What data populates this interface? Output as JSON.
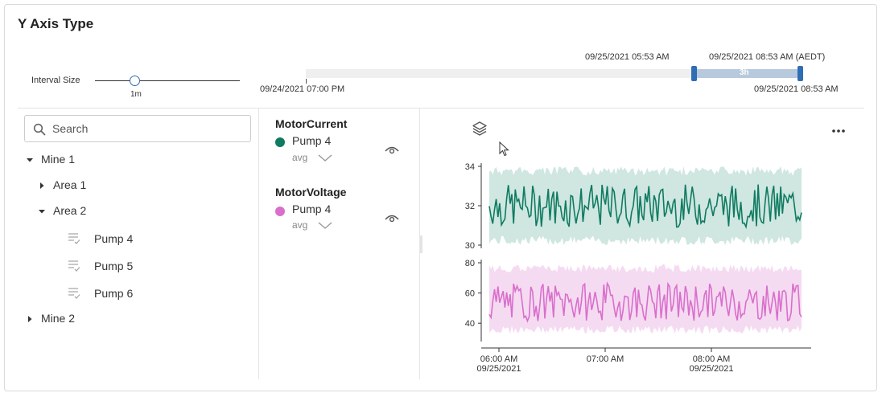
{
  "header": {
    "title": "Y Axis Type"
  },
  "interval": {
    "label": "Interval Size",
    "value": "1m",
    "fraction": 0.45
  },
  "timeline": {
    "start_label": "09/24/2021 07:00 PM",
    "end_label": "09/25/2021 08:53 AM",
    "selection_start_label": "09/25/2021 05:53 AM",
    "selection_end_label": "09/25/2021 08:53 AM (AEDT)",
    "selection_duration": "3h"
  },
  "search": {
    "placeholder": "Search",
    "value": ""
  },
  "tree": {
    "mine1": "Mine 1",
    "area1": "Area 1",
    "area2": "Area 2",
    "pumps": [
      "Pump 4",
      "Pump 5",
      "Pump 6"
    ],
    "mine2": "Mine 2"
  },
  "series": [
    {
      "title": "MotorCurrent",
      "label": "Pump 4",
      "aggregation": "avg",
      "color": "#0f7b61"
    },
    {
      "title": "MotorVoltage",
      "label": "Pump 4",
      "aggregation": "avg",
      "color": "#d96fcc"
    }
  ],
  "colors": {
    "current_line": "#0f7b61",
    "current_band": "#cfe6e1",
    "voltage_line": "#d96fcc",
    "voltage_band": "#f5dbf1",
    "selection": "#b7c9dc",
    "handle": "#2f6db5"
  },
  "chart_data": {
    "type": "line",
    "x_ticks": [
      {
        "time": "06:00 AM",
        "date": "09/25/2021"
      },
      {
        "time": "07:00 AM",
        "date": ""
      },
      {
        "time": "08:00 AM",
        "date": "09/25/2021"
      }
    ],
    "x_range": [
      "09/25/2021 05:53 AM",
      "09/25/2021 08:53 AM"
    ],
    "panels": [
      {
        "series": "MotorCurrent",
        "ylim": [
          30,
          34
        ],
        "yticks": [
          30,
          32,
          34
        ],
        "avg_range": [
          30.8,
          33.2
        ],
        "band_range": [
          30,
          34
        ]
      },
      {
        "series": "MotorVoltage",
        "ylim": [
          30,
          80
        ],
        "yticks": [
          40,
          60,
          80
        ],
        "avg_range": [
          40,
          68
        ],
        "band_range": [
          33,
          79
        ]
      }
    ]
  }
}
